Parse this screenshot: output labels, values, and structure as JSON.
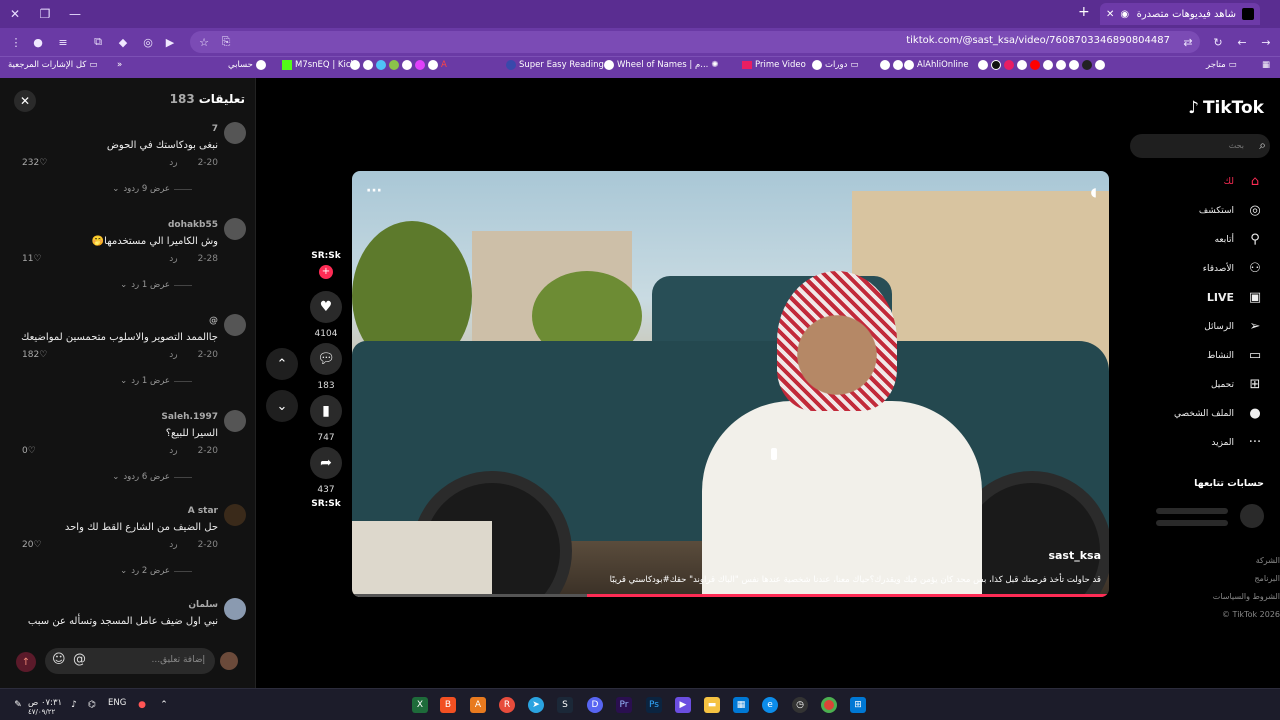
{
  "browser": {
    "tab_title": "شاهد فيديوهات متصدرة | :k",
    "url": "tiktok.com/@sast_ksa/video/7608703346890804487",
    "bookmarks": [
      "حسابي",
      "M7snEQ | Kick",
      "Super Easy Reading",
      "Wheel of Names | م...",
      "Prime Video",
      "دورات",
      "AlAhliOnline",
      "متاجر",
      "كل الإشارات المرجعية"
    ],
    "accent": "#5a2d91"
  },
  "comments_panel": {
    "title": "تعليقات",
    "count": "183",
    "reply_label": "رد",
    "input_placeholder": "إضافة تعليق...",
    "comments": [
      {
        "user": "7",
        "text": "نبغى بودكاستك في الحوض",
        "date": "2-20",
        "likes": "232",
        "replies": "عرض 9 ردود"
      },
      {
        "user": "dohakb55",
        "text": "وش الكاميرا الي مستخدمها🤭",
        "date": "2-28",
        "likes": "11",
        "replies": "عرض 1 رد"
      },
      {
        "user": "@",
        "text": "جاالممد التصوير والاسلوب متحمسين لمواضيعك",
        "date": "2-20",
        "likes": "182",
        "replies": "عرض 1 رد"
      },
      {
        "user": "Saleh.1997",
        "text": "السيرا للبيع؟",
        "date": "2-20",
        "likes": "0",
        "replies": "عرض 6 ردود"
      },
      {
        "user": "A star",
        "text": "حل الضيف من الشارع القط لك واحد",
        "date": "2-20",
        "likes": "20",
        "replies": "عرض 2 رد"
      },
      {
        "user": "سلمان",
        "text": "نبي اول ضيف عامل المسجد وتسأله عن سبب",
        "date": "",
        "likes": "",
        "replies": ""
      }
    ]
  },
  "video": {
    "username": "sast_ksa",
    "caption": "قد حاولت تأخذ فرصتك قبل كذا، بس محد كان يؤمن فيك ويقدرك؟حياك معنا، عندنا شخصية عندها نفس \"الباك قراوند\" حقك#بودكاستي قريبًا",
    "author_tag": "SR:Sk",
    "progress": 0.69
  },
  "actions": {
    "likes": "4104",
    "comments": "183",
    "saves": "747",
    "shares": "437",
    "sound_tag": "SR:Sk"
  },
  "sidebar": {
    "logo": "TikTok",
    "search_placeholder": "بحث",
    "nav": [
      "لك",
      "استكشف",
      "أتابعه",
      "الأصدقاء",
      "LIVE",
      "الرسائل",
      "النشاط",
      "تحميل",
      "الملف الشخصي",
      "المزيد"
    ],
    "following_title": "حسابات تتابعها",
    "footer": [
      "الشركة",
      "البرنامج",
      "الشروط والسياسات",
      "TikTok 2026 ©"
    ]
  },
  "taskbar": {
    "time": "٠٧:٣١ ص",
    "date": "٤٧/٠٩/٢٢",
    "lang": "ENG"
  }
}
